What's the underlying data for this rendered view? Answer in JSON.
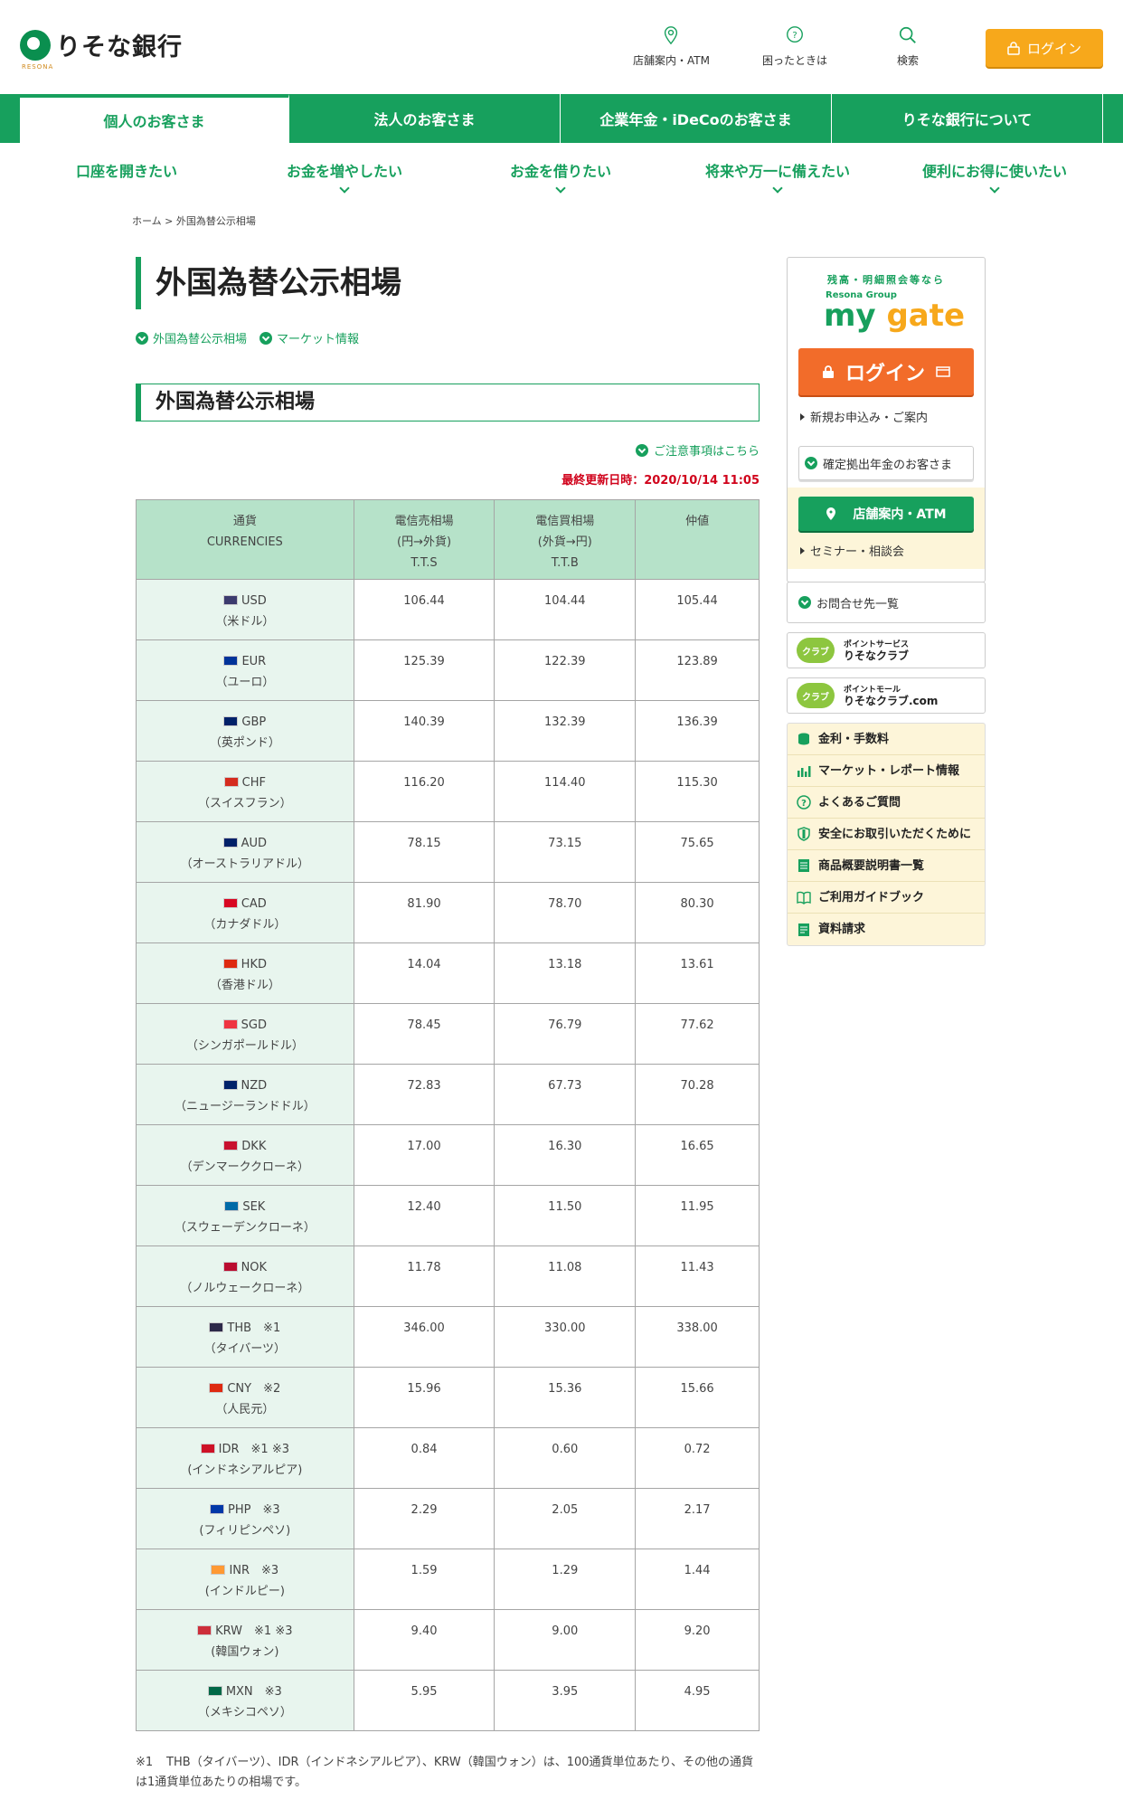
{
  "header": {
    "logo_text": "りそな銀行",
    "logo_sub": "RESONA",
    "links": [
      {
        "label": "店舗案内・ATM",
        "icon": "location-pin-icon"
      },
      {
        "label": "困ったときは",
        "icon": "question-bubble-icon"
      },
      {
        "label": "検索",
        "icon": "search-icon"
      }
    ],
    "login_label": "ログイン"
  },
  "mainnav": [
    "個人のお客さま",
    "法人のお客さま",
    "企業年金・iDeCoのお客さま",
    "りそな銀行について"
  ],
  "subnav": [
    "口座を開きたい",
    "お金を増やしたい",
    "お金を借りたい",
    "将来や万一に備えたい",
    "便利にお得に使いたい"
  ],
  "breadcrumb": {
    "home": "ホーム",
    "sep": ">",
    "current": "外国為替公示相場"
  },
  "page": {
    "title": "外国為替公示相場",
    "anchors": [
      "外国為替公示相場",
      "マーケット情報"
    ],
    "section_title": "外国為替公示相場",
    "notice_link": "ご注意事項はこちら",
    "updated": "最終更新日時：2020/10/14 11:05"
  },
  "table": {
    "headers": [
      {
        "l1": "通貨",
        "l2": "CURRENCIES",
        "l3": ""
      },
      {
        "l1": "電信売相場",
        "l2": "(円→外貨)",
        "l3": "T.T.S"
      },
      {
        "l1": "電信買相場",
        "l2": "(外貨→円)",
        "l3": "T.T.B"
      },
      {
        "l1": "仲値",
        "l2": "",
        "l3": ""
      }
    ],
    "rows": [
      {
        "code": "USD",
        "name": "（米ドル）",
        "tts": "106.44",
        "ttb": "104.44",
        "mid": "105.44",
        "flag": "#3c3b6e"
      },
      {
        "code": "EUR",
        "name": "（ユーロ）",
        "tts": "125.39",
        "ttb": "122.39",
        "mid": "123.89",
        "flag": "#003399"
      },
      {
        "code": "GBP",
        "name": "（英ポンド）",
        "tts": "140.39",
        "ttb": "132.39",
        "mid": "136.39",
        "flag": "#012169"
      },
      {
        "code": "CHF",
        "name": "（スイスフラン）",
        "tts": "116.20",
        "ttb": "114.40",
        "mid": "115.30",
        "flag": "#d52b1e"
      },
      {
        "code": "AUD",
        "name": "（オーストラリアドル）",
        "tts": "78.15",
        "ttb": "73.15",
        "mid": "75.65",
        "flag": "#012169"
      },
      {
        "code": "CAD",
        "name": "（カナダドル）",
        "tts": "81.90",
        "ttb": "78.70",
        "mid": "80.30",
        "flag": "#d80621"
      },
      {
        "code": "HKD",
        "name": "（香港ドル）",
        "tts": "14.04",
        "ttb": "13.18",
        "mid": "13.61",
        "flag": "#de2910"
      },
      {
        "code": "SGD",
        "name": "（シンガポールドル）",
        "tts": "78.45",
        "ttb": "76.79",
        "mid": "77.62",
        "flag": "#ef3340"
      },
      {
        "code": "NZD",
        "name": "（ニュージーランドドル）",
        "tts": "72.83",
        "ttb": "67.73",
        "mid": "70.28",
        "flag": "#012169"
      },
      {
        "code": "DKK",
        "name": "（デンマーククローネ）",
        "tts": "17.00",
        "ttb": "16.30",
        "mid": "16.65",
        "flag": "#c8102e"
      },
      {
        "code": "SEK",
        "name": "（スウェーデンクローネ）",
        "tts": "12.40",
        "ttb": "11.50",
        "mid": "11.95",
        "flag": "#006aa7"
      },
      {
        "code": "NOK",
        "name": "（ノルウェークローネ）",
        "tts": "11.78",
        "ttb": "11.08",
        "mid": "11.43",
        "flag": "#ba0c2f"
      },
      {
        "code": "THB　※1",
        "name": "（タイバーツ）",
        "tts": "346.00",
        "ttb": "330.00",
        "mid": "338.00",
        "flag": "#2d2a4a"
      },
      {
        "code": "CNY　※2",
        "name": "（人民元）",
        "tts": "15.96",
        "ttb": "15.36",
        "mid": "15.66",
        "flag": "#de2910"
      },
      {
        "code": "IDR　※1 ※3",
        "name": "(インドネシアルピア)",
        "tts": "0.84",
        "ttb": "0.60",
        "mid": "0.72",
        "flag": "#ce1126"
      },
      {
        "code": "PHP　※3",
        "name": "(フィリピンペソ)",
        "tts": "2.29",
        "ttb": "2.05",
        "mid": "2.17",
        "flag": "#0038a8"
      },
      {
        "code": "INR　※3",
        "name": "(インドルピー)",
        "tts": "1.59",
        "ttb": "1.29",
        "mid": "1.44",
        "flag": "#ff9933"
      },
      {
        "code": "KRW　※1 ※3",
        "name": "(韓国ウォン)",
        "tts": "9.40",
        "ttb": "9.00",
        "mid": "9.20",
        "flag": "#cd2e3a"
      },
      {
        "code": "MXN　※3",
        "name": "（メキシコペソ）",
        "tts": "5.95",
        "ttb": "3.95",
        "mid": "4.95",
        "flag": "#006847"
      }
    ]
  },
  "footnote": {
    "mark": "※1",
    "text": "THB（タイバーツ）、IDR（インドネシアルピア）、KRW（韓国ウォン）は、100通貨単位あたり、その他の通貨は1通貨単位あたりの相場です。"
  },
  "sidebar": {
    "mygate_small": "残高・明細照会等なら",
    "mygate_group": "Resona Group",
    "mygate_logo_a": "my ",
    "mygate_logo_b": "gate",
    "mygate_login": "ログイン",
    "apply_link": "新規お申込み・ご案内",
    "pension_btn": "確定拠出年金のお客さま",
    "store_btn": "店舗案内・ATM",
    "seminar_link": "セミナー・相談会",
    "contact_link": "お問合せ先一覧",
    "club1_logo": "クラブ",
    "club1_sub": "ポイントサービス",
    "club1_name": "りそなクラブ",
    "club2_logo": "クラブ",
    "club2_sub": "ポイントモール",
    "club2_name": "りそなクラブ.com",
    "menu": [
      {
        "label": "金利・手数料",
        "icon": "coins-icon"
      },
      {
        "label": "マーケット・レポート情報",
        "icon": "bar-chart-icon"
      },
      {
        "label": "よくあるご質問",
        "icon": "question-circle-icon"
      },
      {
        "label": "安全にお取引いただくために",
        "icon": "shield-icon"
      },
      {
        "label": "商品概要説明書一覧",
        "icon": "document-icon"
      },
      {
        "label": "ご利用ガイドブック",
        "icon": "book-icon"
      },
      {
        "label": "資料請求",
        "icon": "document-request-icon"
      }
    ]
  },
  "colors": {
    "brand_green": "#17a05d",
    "login_orange": "#f7a81b",
    "mygate_orange": "#f26c2a",
    "updated_red": "#d0021b"
  }
}
